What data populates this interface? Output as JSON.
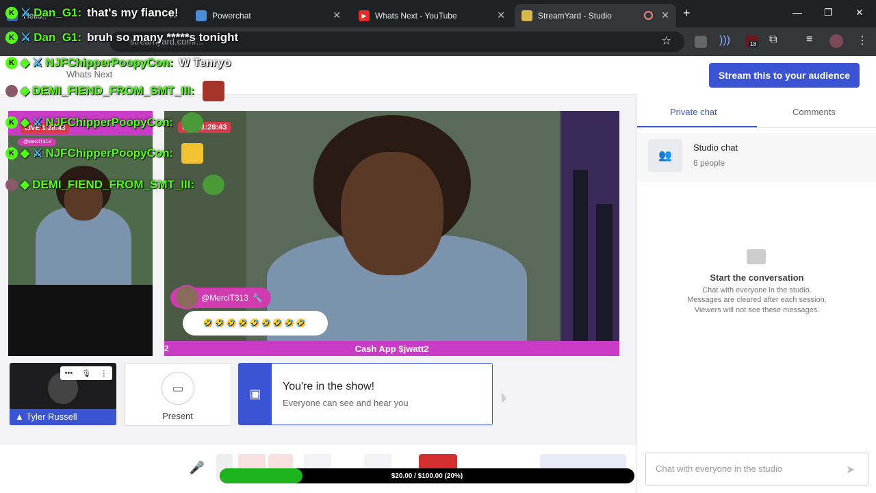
{
  "browser": {
    "tabs": [
      {
        "label": "Hello::",
        "active": false
      },
      {
        "label": "Powerchat",
        "active": false
      },
      {
        "label": "Whats Next - YouTube",
        "active": false
      },
      {
        "label": "StreamYard - Studio",
        "active": true
      }
    ],
    "close_glyph": "✕",
    "new_tab_glyph": "+",
    "url": "streamyard.com/...",
    "extension_badge": "18"
  },
  "studio": {
    "broadcast_title": "Whats Next",
    "stream_button": "Stream this to your audience",
    "left_live": "LIVE 1:28:43",
    "left_tag": "@MerciT313",
    "main_live": "LIVE 1:28:43",
    "message_user": "@MerciT313",
    "message_text": "🤣🤣🤣🤣🤣🤣🤣🤣🤣",
    "cash_banner": "Cash App $jwatt2",
    "cash_side": "2"
  },
  "tiles": {
    "camera_name": "Tyler Russell",
    "present_label": "Present",
    "show_title": "You're in the show!",
    "show_subtitle": "Everyone can see and hear you"
  },
  "progress": {
    "text": "$20.00 / $100.00 (20%)",
    "fraction": 0.2
  },
  "chat_panel": {
    "tab_private": "Private chat",
    "tab_comments": "Comments",
    "card_title": "Studio chat",
    "card_subtitle": "6 people",
    "empty_title": "Start the conversation",
    "empty_line1": "Chat with everyone in the studio.",
    "empty_line2": "Messages are cleared after each session.",
    "empty_line3": "Viewers will not see these messages.",
    "input_placeholder": "Chat with everyone in the studio"
  },
  "overlay_chat": [
    {
      "user": "Dan_G1:",
      "text": "that's my fiance!"
    },
    {
      "user": "Dan_G1:",
      "text": "bruh so many *****s tonight"
    },
    {
      "user": "NJFChipperPoopyCon:",
      "text": "W Tenryo"
    },
    {
      "user": "DEMI_FIEND_FROM_SMT_III:",
      "text": ""
    },
    {
      "user": "NJFChipperPoopyCon:",
      "text": ""
    },
    {
      "user": "NJFChipperPoopyCon:",
      "text": ""
    },
    {
      "user": "DEMI_FIEND_FROM_SMT_III:",
      "text": ""
    }
  ],
  "colors": {
    "accent": "#3a54d4",
    "overlay_name": "#53fc18",
    "banner": "#c83cc6",
    "progress_fill": "#1db31d"
  }
}
